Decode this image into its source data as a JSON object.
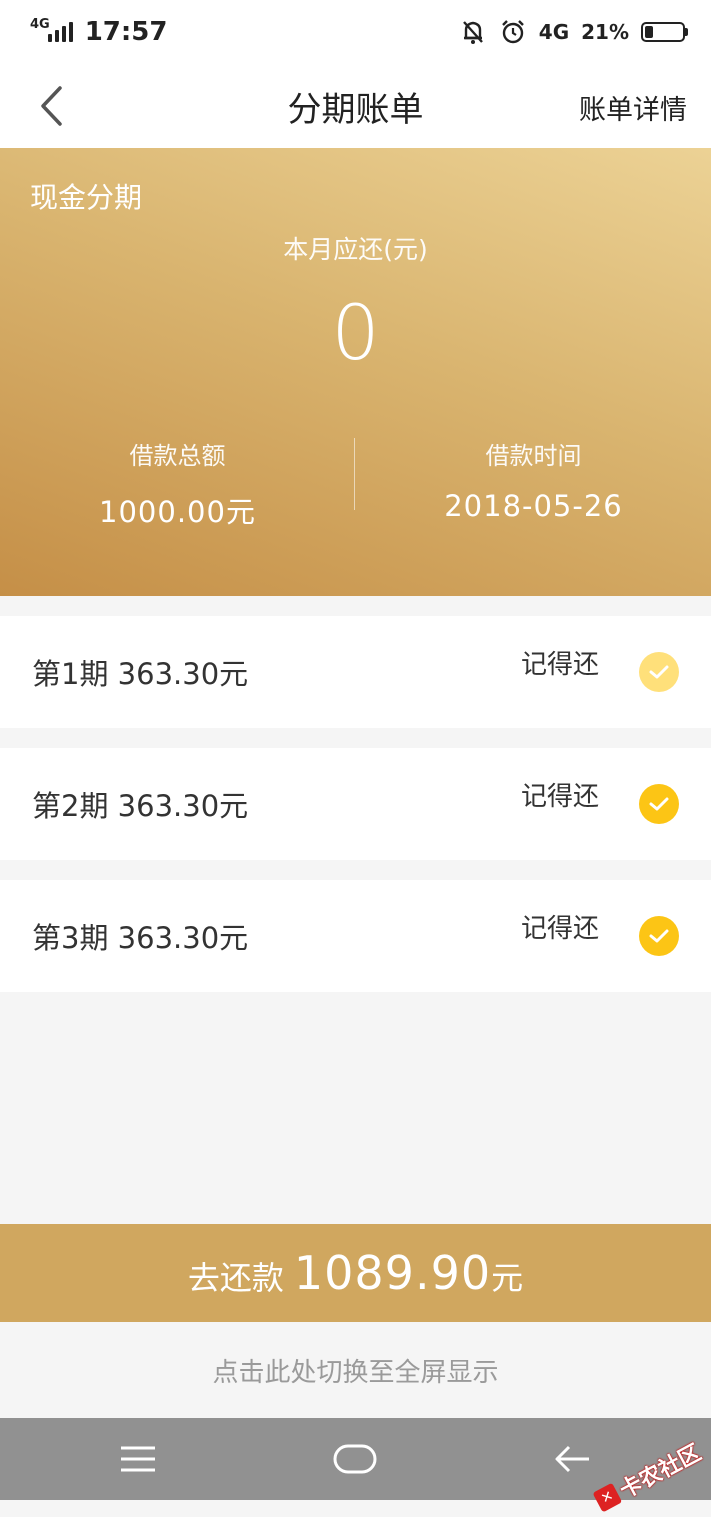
{
  "status_bar": {
    "network": "4G",
    "time": "17:57",
    "network_right": "4G",
    "battery_percent": "21%",
    "battery_level": 0.21
  },
  "nav": {
    "title": "分期账单",
    "right_link": "账单详情"
  },
  "hero": {
    "product": "现金分期",
    "due_label": "本月应还(元)",
    "due_amount": "0",
    "loan_total_label": "借款总额",
    "loan_total_value": "1000.00元",
    "loan_time_label": "借款时间",
    "loan_time_value": "2018-05-26"
  },
  "installments": [
    {
      "title": "第1期 363.30元",
      "status": "记得还",
      "check_color": "#ffe07a"
    },
    {
      "title": "第2期 363.30元",
      "status": "记得还",
      "check_color": "#fcc515"
    },
    {
      "title": "第3期 363.30元",
      "status": "记得还",
      "check_color": "#fcc515"
    }
  ],
  "pay_bar": {
    "label": "去还款",
    "amount": "1089.90",
    "unit": "元"
  },
  "fullscreen_tip": "点击此处切换至全屏显示",
  "watermark": "卡农社区",
  "colors": {
    "gold_bar": "#d0a75f",
    "hero_light": "#ecd295",
    "hero_dark": "#c58f47",
    "check_yellow": "#fcc515"
  }
}
